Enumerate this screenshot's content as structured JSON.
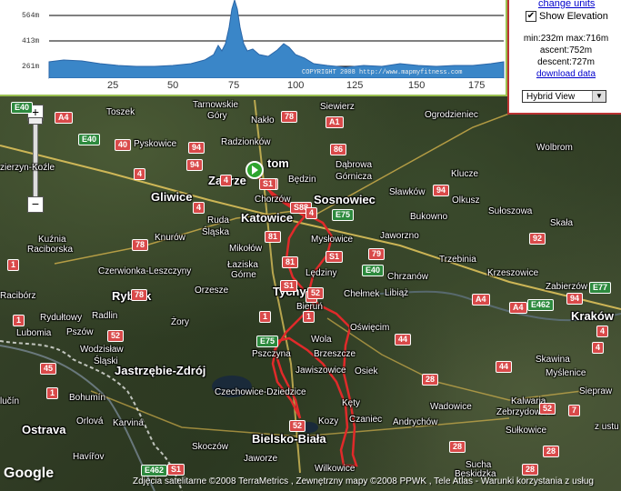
{
  "elevation": {
    "y_ticks": [
      "564m",
      "413m",
      "261m"
    ],
    "x_ticks": [
      "25",
      "50",
      "75",
      "100",
      "125",
      "150",
      "175"
    ],
    "copyright": "COPYRIGHT 2008 http://www.mapmyfitness.com"
  },
  "panel": {
    "change_units": "change units",
    "show_elevation": "Show Elevation",
    "checkbox_mark": "✔",
    "minmax": "min:232m max:716m",
    "ascent": "ascent:752m",
    "descent": "descent:727m",
    "download": "download data",
    "view": "Hybrid View",
    "view_arrow": "▼"
  },
  "zoom": {
    "plus": "+",
    "minus": "−"
  },
  "places": {
    "toszek": "Toszek",
    "tarnowskie": "Tarnowskie",
    "gory": "Góry",
    "naklo": "Nakło",
    "siewierz": "Siewierz",
    "ogrodzieniec": "Ogrodzieniec",
    "wolbrom": "Wolbrom",
    "pyskowice": "Pyskowice",
    "radzionkow": "Radzionków",
    "kozle": "zierzyn-Koźle",
    "bytom": "tom",
    "zabrze": "Zabrze",
    "bedzin": "Będzin",
    "dabrowa": "Dąbrowa",
    "gornicza": "Górnicza",
    "klucze": "Klucze",
    "gliwice": "Gliwice",
    "chorzow": "Chorzów",
    "sosnowiec": "Sosnowiec",
    "slawkow": "Sławków",
    "olkusz": "Olkusz",
    "ruda": "Ruda",
    "slaska": "Śląska",
    "katowice": "Katowice",
    "bukowno": "Bukowno",
    "sulowska": "Sułoszowa",
    "skala": "Skała",
    "kuznia": "Kuźnia",
    "raciborska": "Raciborska",
    "knurow": "Knurów",
    "myslowice": "Mysłowice",
    "jaworzno": "Jaworzno",
    "mikolow": "Mikołów",
    "trzebinia": "Trzebinia",
    "czerwionka": "Czerwionka-Leszczyny",
    "laziska": "Łaziska",
    "gorne": "Górne",
    "ledziny": "Lędziny",
    "chrzanow": "Chrzanów",
    "krzeszowice": "Krzeszowice",
    "zabierzow": "Zabierzów",
    "orzesze": "Orzesze",
    "tychy": "Tychy",
    "chelmek": "Chełmek",
    "libiaz": "Libiąż",
    "raciborz": "Racibórz",
    "rybnik": "Rybnik",
    "bierun": "Bieruń",
    "rydultowy": "Rydułtowy",
    "radlin": "Radlin",
    "zory": "Żory",
    "krakow": "Kraków",
    "lubomia": "Lubomia",
    "pszow": "Pszów",
    "oswiecim": "Oświęcim",
    "wola": "Wola",
    "wodzislaw": "Wodzisław",
    "slaski": "Śląski",
    "pszczyna": "Pszczyna",
    "brzeszcze": "Brzeszcze",
    "skawina": "Skawina",
    "jastrzebie": "Jastrzębie-Zdrój",
    "jawiszowice": "Jawiszowice",
    "osiek": "Osiek",
    "myslenice": "Myślenice",
    "sieprasz": "Siepraw",
    "bohumin": "Bohumín",
    "czechowice": "Czechowice-Dziedzice",
    "kety": "Kęty",
    "wadowice": "Wadowice",
    "kalwaria": "Kalwaria",
    "zebrzydowska": "Zebrzydowska",
    "lucin": "lučín",
    "orlova": "Orlová",
    "karvina": "Karviná",
    "kozy": "Kozy",
    "czaniec": "Czaniec",
    "andrychow": "Andrychów",
    "sulkowice": "Sułkowice",
    "ostrava": "Ostrava",
    "bielsko": "Bielsko-Biała",
    "havirov": "Havířov",
    "skoczow": "Skoczów",
    "jaworze": "Jaworze",
    "wilkowice": "Wilkowice",
    "sucha": "Sucha",
    "beskidzka": "Beskidzka",
    "ustuo": "z ustu"
  },
  "roads": [
    "E40",
    "A4",
    "78",
    "94",
    "40",
    "E40",
    "4",
    "94",
    "86",
    "S1",
    "94",
    "A1",
    "S88",
    "E75",
    "4",
    "78",
    "81",
    "79",
    "4",
    "92",
    "78",
    "S1",
    "E40",
    "A4",
    "E462",
    "94",
    "E77",
    "A4",
    "1",
    "81",
    "44",
    "4",
    "45",
    "4",
    "44",
    "1",
    "E75",
    "52",
    "4",
    "1",
    "28",
    "28",
    "52",
    "7",
    "1",
    "52",
    "E462",
    "S1",
    "1",
    "52",
    "28",
    "28",
    "4",
    "S1",
    "S1"
  ],
  "footer": "Zdjęcia satelitarne ©2008 TerraMetrics , Zewnętrzny mapy ©2008 PPWK , Tele Atlas - Warunki korzystania z usług",
  "logo": "Google"
}
